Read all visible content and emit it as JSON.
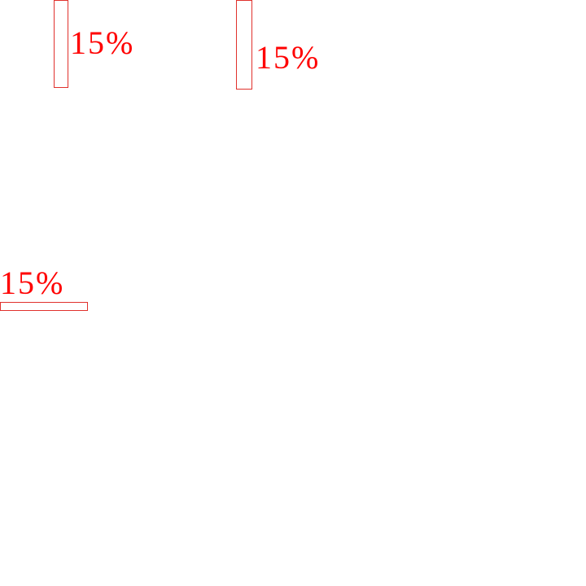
{
  "accent_color": "#ff0000",
  "markers": [
    {
      "label": "15%",
      "orientation": "vertical",
      "level": 0.15
    },
    {
      "label": "15%",
      "orientation": "vertical",
      "level": 0.15
    },
    {
      "label": "15%",
      "orientation": "horizontal",
      "level": 0.15
    }
  ]
}
